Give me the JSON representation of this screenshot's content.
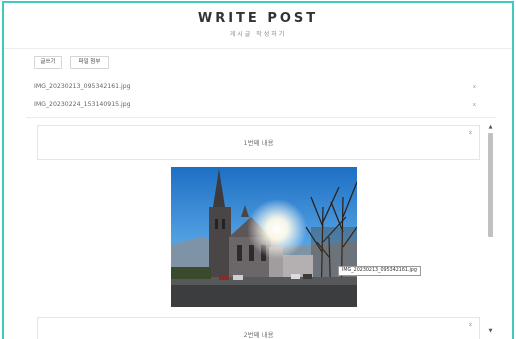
{
  "header": {
    "title": "WRITE POST",
    "subtitle": "게시글 작성하기"
  },
  "toolbar": {
    "write_label": "글쓰기",
    "attach_label": "파일 첨부"
  },
  "files": [
    {
      "name": "IMG_20230213_095342161.jpg",
      "remove": "x"
    },
    {
      "name": "IMG_20230224_153140915.jpg",
      "remove": "x"
    }
  ],
  "editor": {
    "blocks": [
      {
        "label": "1번째 내용",
        "close": "x"
      },
      {
        "label": "2번째 내용",
        "close": "x"
      }
    ],
    "image_tooltip": "IMG_20230213_095342161.jpg"
  },
  "scrollbar": {
    "up_icon": "▲",
    "down_icon": "▼"
  },
  "colors": {
    "frame_border": "#3fc9c0"
  }
}
